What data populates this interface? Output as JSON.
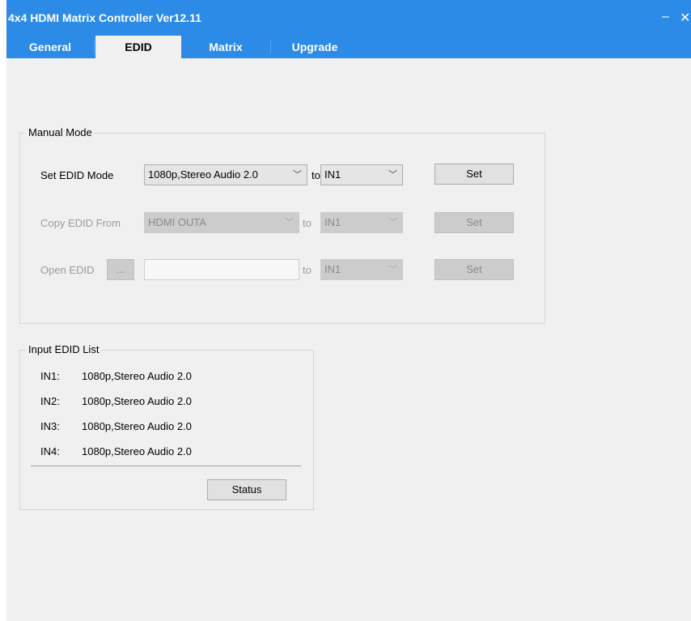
{
  "app": {
    "title": "4x4 HDMI Matrix Controller Ver12.11",
    "minimize_glyph": "–",
    "close_glyph": "✕"
  },
  "tabs": [
    {
      "label": "General",
      "active": false
    },
    {
      "label": "EDID",
      "active": true
    },
    {
      "label": "Matrix",
      "active": false
    },
    {
      "label": "Upgrade",
      "active": false
    }
  ],
  "manual_mode": {
    "title": "Manual Mode",
    "set_edid": {
      "label": "Set EDID Mode",
      "mode_value": "1080p,Stereo Audio 2.0",
      "to_label": "to",
      "target_value": "IN1",
      "button": "Set"
    },
    "copy_edid": {
      "label": "Copy EDID From",
      "source_value": "HDMI OUTA",
      "to_label": "to",
      "target_value": "IN1",
      "button": "Set"
    },
    "open_edid": {
      "label": "Open EDID",
      "browse_button": "...",
      "file_value": "",
      "to_label": "to",
      "target_value": "IN1",
      "button": "Set"
    }
  },
  "input_edid_list": {
    "title": "Input EDID List",
    "rows": [
      {
        "input": "IN1:",
        "value": "1080p,Stereo Audio 2.0"
      },
      {
        "input": "IN2:",
        "value": "1080p,Stereo Audio 2.0"
      },
      {
        "input": "IN3:",
        "value": "1080p,Stereo Audio 2.0"
      },
      {
        "input": "IN4:",
        "value": "1080p,Stereo Audio 2.0"
      }
    ],
    "status_button": "Status"
  },
  "colors": {
    "titlebar": "#2b8be6",
    "window_bg": "#f0f0f0"
  },
  "icons": {
    "minimize": "minimize-icon",
    "close": "close-icon",
    "dropdown": "chevron-down-icon"
  }
}
